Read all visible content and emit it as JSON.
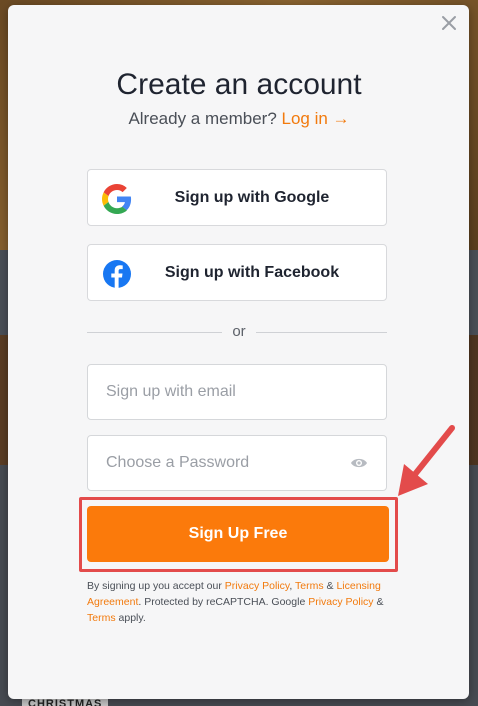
{
  "modal": {
    "title": "Create an account",
    "subtitle_prefix": "Already a member?",
    "login_link": "Log in →"
  },
  "social": {
    "google_label": "Sign up with Google",
    "facebook_label": "Sign up with Facebook"
  },
  "divider_text": "or",
  "form": {
    "email_placeholder": "Sign up with email",
    "password_placeholder": "Choose a Password",
    "submit_label": "Sign Up Free"
  },
  "legal": {
    "t1": "By signing up you accept our ",
    "privacy1": "Privacy Policy",
    "comma": ", ",
    "terms1": "Terms",
    "and1": " & ",
    "licensing": "Licensing Agreement",
    "t2": ". Protected by reCAPTCHA. Google ",
    "privacy2": "Privacy Policy",
    "and2": " & ",
    "terms2": "Terms",
    "t3": " apply."
  },
  "background": {
    "banner_text": "CHRISTMAS"
  },
  "colors": {
    "accent": "#fb7a0b",
    "link": "#f27a0d",
    "highlight": "#e34b4b",
    "facebook": "#1877f2"
  },
  "icons": [
    "close-icon",
    "google-icon",
    "facebook-icon",
    "eye-icon",
    "annotation-arrow-icon"
  ]
}
